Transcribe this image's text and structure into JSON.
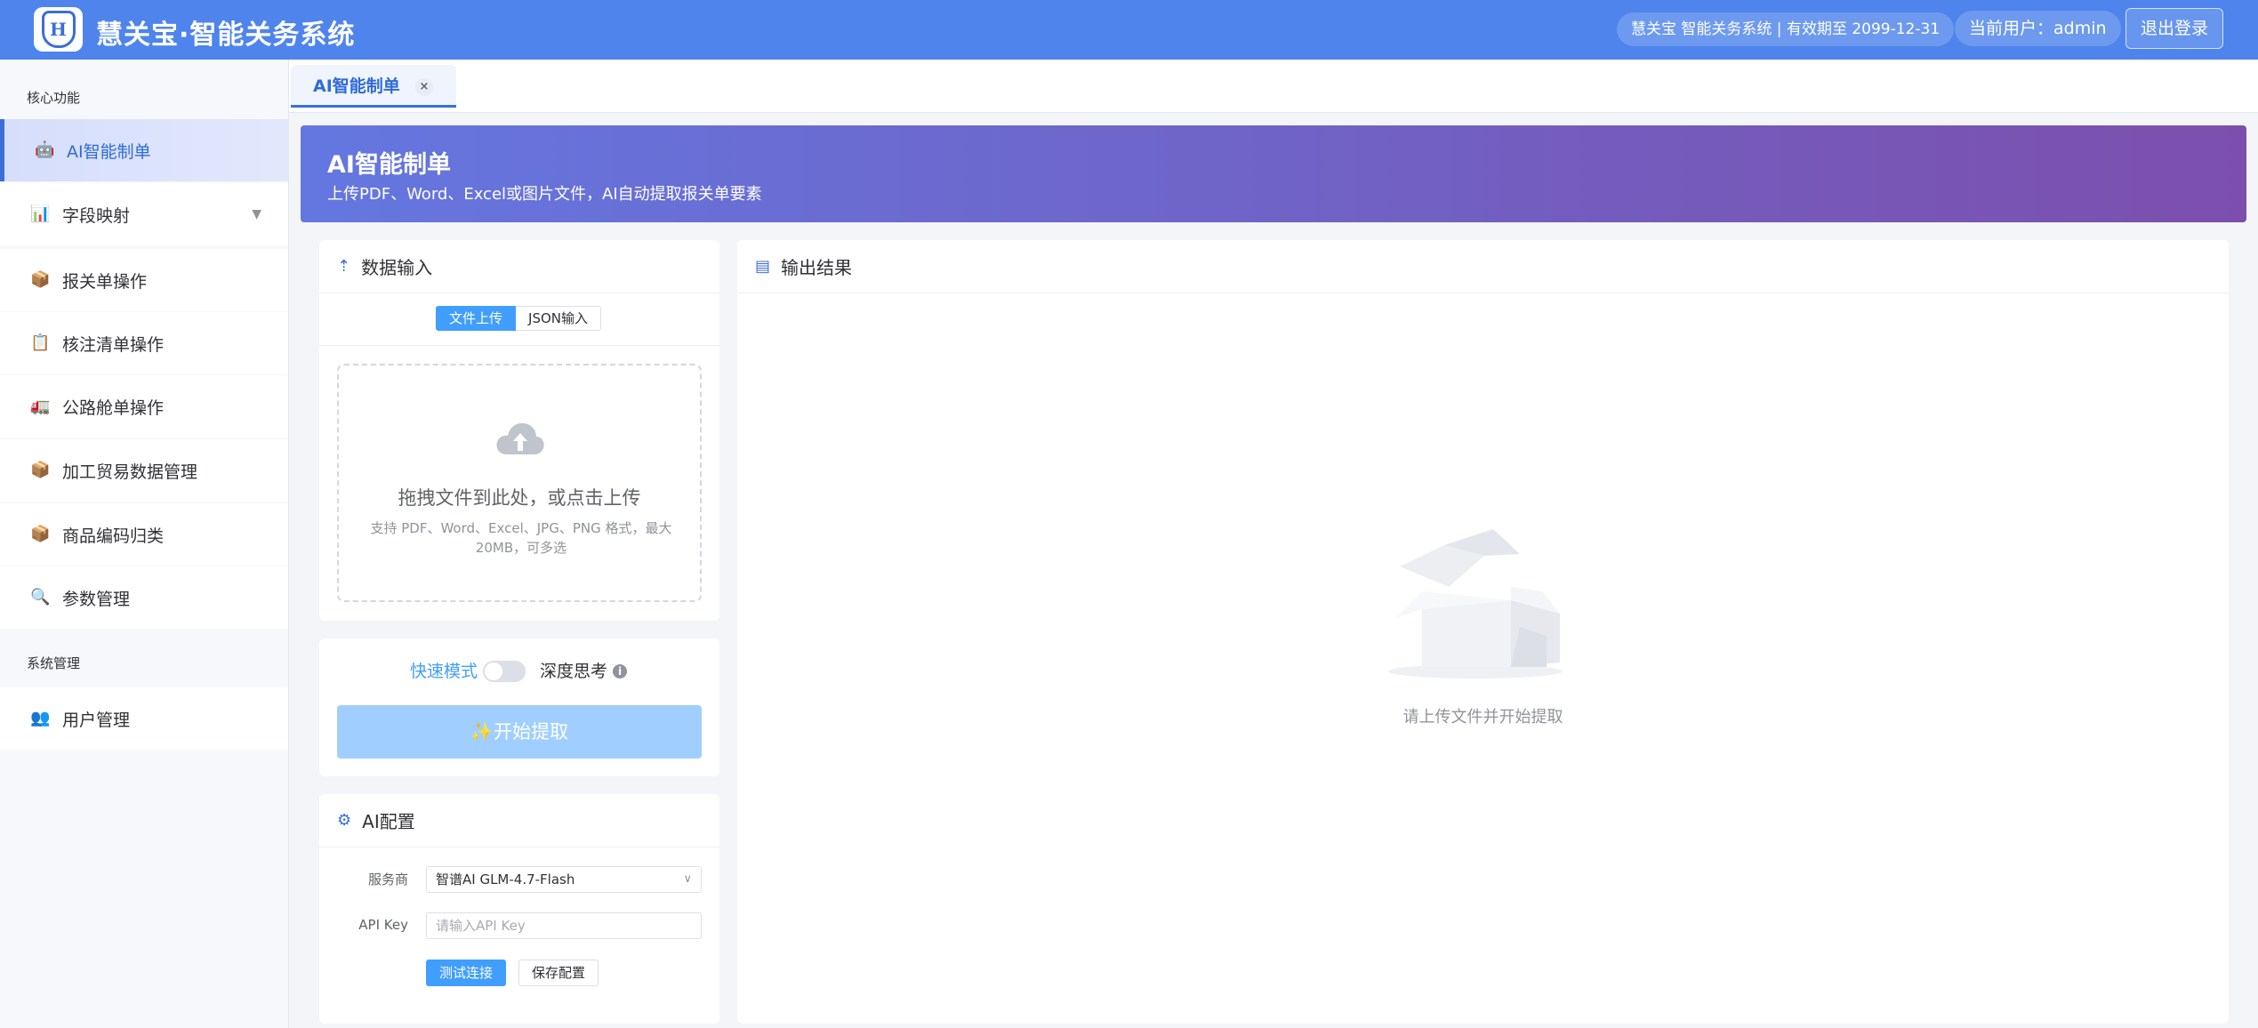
{
  "header": {
    "app_title": "慧关宝·智能关务系统",
    "logo_letter": "H",
    "license": "慧关宝 智能关务系统 | 有效期至 2099-12-31",
    "user": "当前用户：admin",
    "logout_label": "退出登录"
  },
  "sidebar": {
    "section_core": "核心功能",
    "section_system": "系统管理",
    "items": [
      {
        "label": "AI智能制单",
        "icon": "robot-icon",
        "glyph": "🤖"
      },
      {
        "label": "字段映射",
        "icon": "bar-chart-icon",
        "glyph": "📊"
      },
      {
        "label": "报关单操作",
        "icon": "package-icon",
        "glyph": "📦"
      },
      {
        "label": "核注清单操作",
        "icon": "clipboard-icon",
        "glyph": "📋"
      },
      {
        "label": "公路舱单操作",
        "icon": "truck-icon",
        "glyph": "🚛"
      },
      {
        "label": "加工贸易数据管理",
        "icon": "package-icon",
        "glyph": "📦"
      },
      {
        "label": "商品编码归类",
        "icon": "package-icon",
        "glyph": "📦"
      },
      {
        "label": "参数管理",
        "icon": "magnifier-icon",
        "glyph": "🔍"
      },
      {
        "label": "用户管理",
        "icon": "users-icon",
        "glyph": "👥"
      }
    ],
    "expand_arrow": "▼"
  },
  "tabs": [
    {
      "label": "AI智能制单",
      "close": "×"
    }
  ],
  "banner": {
    "title": "AI智能制单",
    "subtitle": "上传PDF、Word、Excel或图片文件，AI自动提取报关单要素"
  },
  "input_card": {
    "title": "数据输入",
    "mode_file": "文件上传",
    "mode_json": "JSON输入",
    "drop_main": "拖拽文件到此处，或点击上传",
    "drop_tip": "支持 PDF、Word、Excel、JPG、PNG 格式，最大20MB，可多选"
  },
  "extract_card": {
    "fast_mode": "快速模式",
    "deep_mode": "深度思考",
    "info_glyph": "i",
    "extract_label": "✨开始提取"
  },
  "ai_config": {
    "title": "AI配置",
    "provider_label": "服务商",
    "provider_value": "智谱AI GLM-4.7-Flash",
    "apikey_label": "API Key",
    "apikey_placeholder": "请输入API Key",
    "test_label": "测试连接",
    "save_label": "保存配置"
  },
  "output_card": {
    "title": "输出结果",
    "empty_text": "请上传文件并开始提取"
  },
  "colors": {
    "header_bg": "#4e84ec",
    "primary": "#409eff",
    "accent": "#3a6fd8",
    "banner_start": "#6477e0",
    "banner_end": "#7c4fad"
  }
}
